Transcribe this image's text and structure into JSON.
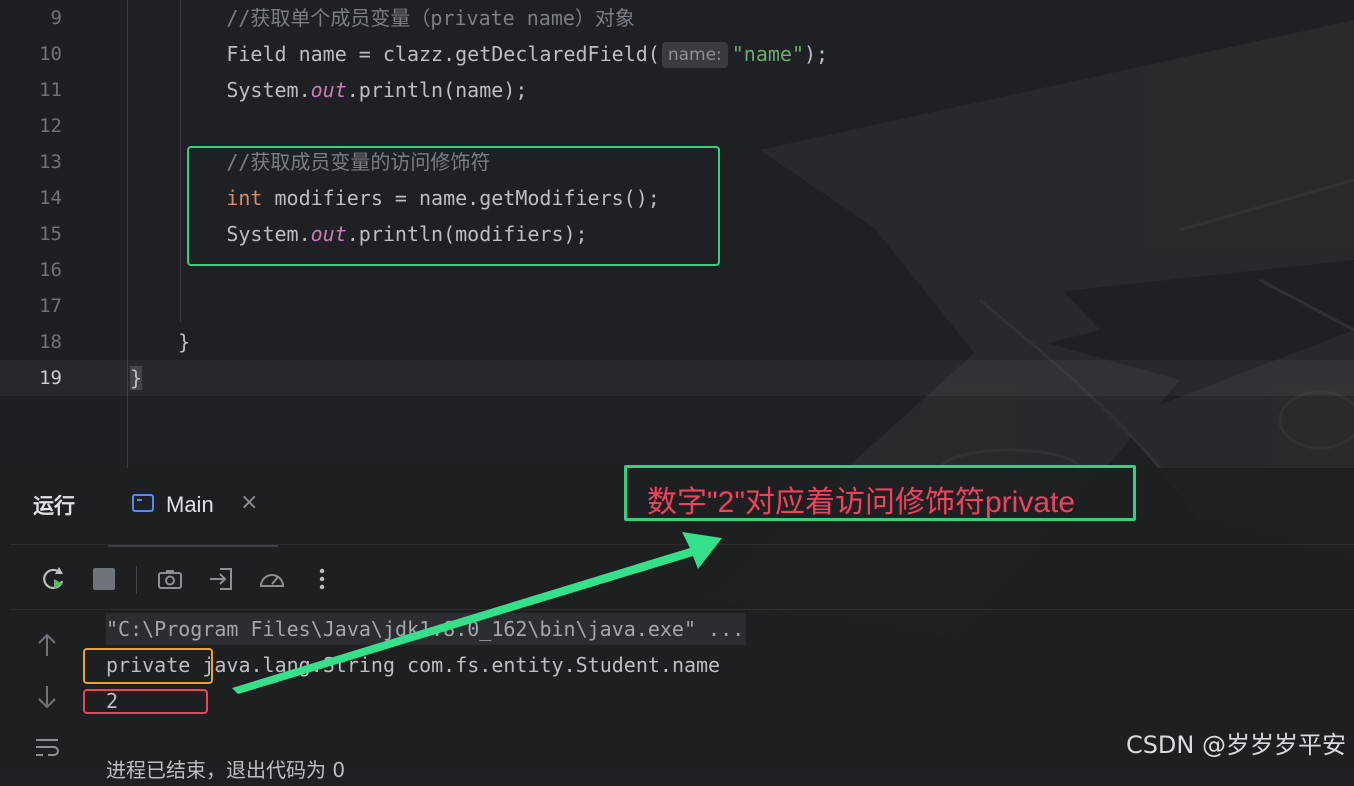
{
  "editor": {
    "lines": [
      {
        "num": "9",
        "parts": [
          {
            "t": "        //获取单个成员变量（private name）对象",
            "c": "cmt"
          }
        ]
      },
      {
        "num": "10",
        "parts": [
          {
            "t": "        Field name = clazz.getDeclaredField(",
            "c": ""
          },
          {
            "t": "name:",
            "c": "hint"
          },
          {
            "t": "\"name\"",
            "c": "str"
          },
          {
            "t": ");",
            "c": ""
          }
        ]
      },
      {
        "num": "11",
        "parts": [
          {
            "t": "        System.",
            "c": ""
          },
          {
            "t": "out",
            "c": "fld"
          },
          {
            "t": ".println(name);",
            "c": ""
          }
        ]
      },
      {
        "num": "12",
        "parts": []
      },
      {
        "num": "13",
        "parts": [
          {
            "t": "        //获取成员变量的访问修饰符",
            "c": "cmt"
          }
        ]
      },
      {
        "num": "14",
        "parts": [
          {
            "t": "        ",
            "c": ""
          },
          {
            "t": "int",
            "c": "kw"
          },
          {
            "t": " modifiers = name.getModifiers();",
            "c": ""
          }
        ]
      },
      {
        "num": "15",
        "parts": [
          {
            "t": "        System.",
            "c": ""
          },
          {
            "t": "out",
            "c": "fld"
          },
          {
            "t": ".println(modifiers);",
            "c": ""
          }
        ]
      },
      {
        "num": "16",
        "parts": []
      },
      {
        "num": "17",
        "parts": []
      },
      {
        "num": "18",
        "parts": [
          {
            "t": "    }",
            "c": ""
          }
        ]
      },
      {
        "num": "19",
        "parts": [
          {
            "t": "}",
            "c": "brace-hl"
          }
        ],
        "current": true
      }
    ]
  },
  "run_panel": {
    "title": "运行",
    "tab_label": "Main",
    "tab_close": "×",
    "toolbar_icons": [
      "rerun-icon",
      "stop-icon",
      "camera-icon",
      "exit-icon",
      "speedometer-icon",
      "more-icon"
    ],
    "output": {
      "cmdline": "\"C:\\Program Files\\Java\\jdk1.8.0_162\\bin\\java.exe\" ...",
      "line1_private": "private",
      "line1_rest": " java.lang.String com.fs.entity.Student.name",
      "line2": "2",
      "status": "进程已结束，退出代码为 0"
    }
  },
  "annotation": {
    "text": "数字\"2\"对应着访问修饰符private",
    "colors": {
      "box": "#35d07f",
      "text": "#f0415f",
      "private_box": "#f0a030",
      "value_box": "#e8445a"
    }
  },
  "watermark": "CSDN @岁岁岁平安"
}
